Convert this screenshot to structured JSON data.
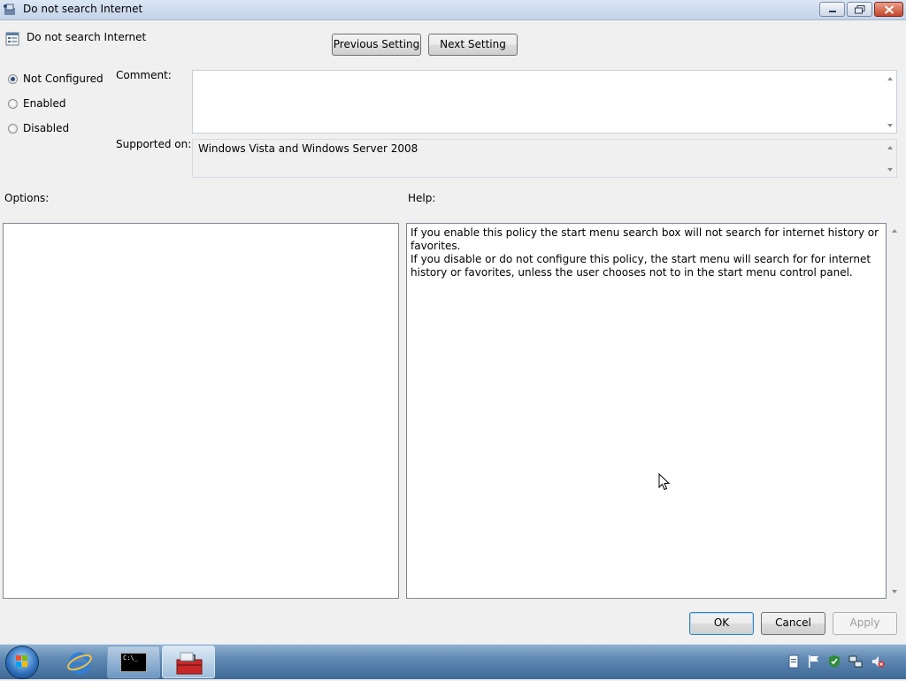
{
  "window": {
    "title": "Do not search Internet",
    "buttons": {
      "minimize": "minimize",
      "maximize": "restore",
      "close": "close"
    }
  },
  "header": {
    "policy_name": "Do not search Internet",
    "prev_label": "Previous Setting",
    "next_label": "Next Setting"
  },
  "state": {
    "options": [
      {
        "label": "Not Configured",
        "selected": true
      },
      {
        "label": "Enabled",
        "selected": false
      },
      {
        "label": "Disabled",
        "selected": false
      }
    ]
  },
  "comment": {
    "label": "Comment:",
    "value": ""
  },
  "supported": {
    "label": "Supported on:",
    "value": "Windows Vista and Windows Server 2008"
  },
  "options_panel": {
    "label": "Options:"
  },
  "help_panel": {
    "label": "Help:",
    "paragraphs": [
      "If you enable this policy the start menu search box will not search for internet history or favorites.",
      "If you disable or do not configure this policy, the start menu will search for for internet history or favorites, unless the user chooses not to in the start menu control panel."
    ]
  },
  "footer": {
    "ok": "OK",
    "cancel": "Cancel",
    "apply": "Apply"
  },
  "taskbar": {
    "items": [
      "start-orb",
      "internet-explorer-icon",
      "command-prompt-icon",
      "group-policy-toolbox-icon"
    ],
    "tray": [
      "document-icon",
      "flag-icon",
      "shield-icon",
      "network-icon",
      "volume-muted-icon"
    ]
  },
  "colors": {
    "accent": "#3c7fb1",
    "taskbar": "#5f89b2",
    "titlebar": "#c4d3e8"
  }
}
